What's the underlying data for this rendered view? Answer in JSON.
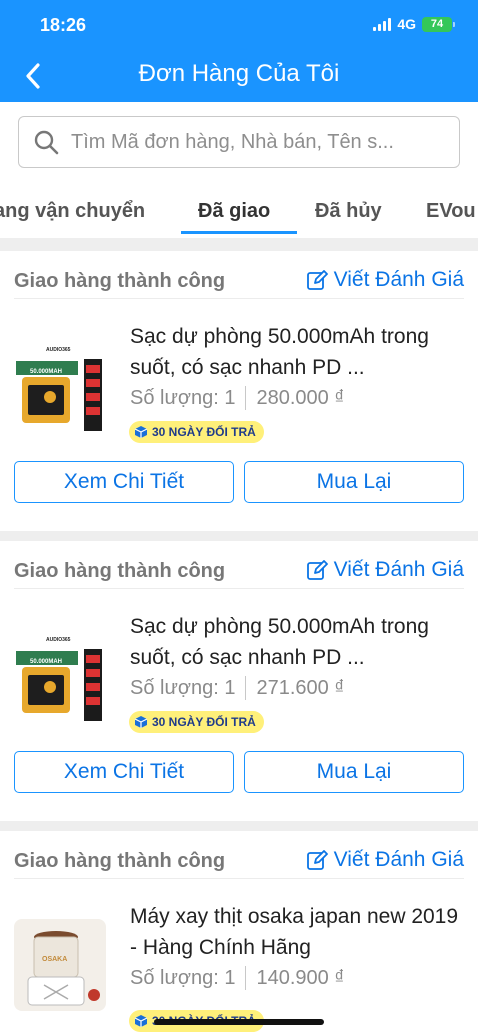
{
  "status_bar": {
    "time": "18:26",
    "network": "4G",
    "battery": "74"
  },
  "header": {
    "title": "Đơn Hàng Của Tôi"
  },
  "search": {
    "placeholder": "Tìm Mã đơn hàng, Nhà bán, Tên s..."
  },
  "tabs": [
    {
      "label": "ang vận chuyển",
      "active": false
    },
    {
      "label": "Đã giao",
      "active": true
    },
    {
      "label": "Đã hủy",
      "active": false
    },
    {
      "label": "EVou",
      "active": false
    }
  ],
  "orders": [
    {
      "status": "Giao hàng thành công",
      "review_label": "Viết Đánh Giá",
      "product_name": "Sạc dự phòng 50.000mAh trong suốt, có sạc nhanh PD ...",
      "quantity_label": "Số lượng: 1",
      "price": "280.000 ₫",
      "badge": "30 NGÀY ĐỔI TRẢ",
      "detail_label": "Xem Chi Tiết",
      "rebuy_label": "Mua Lại",
      "thumb_text": {
        "brand": "AUDIO365",
        "capacity": "50.000MAH"
      }
    },
    {
      "status": "Giao hàng thành công",
      "review_label": "Viết Đánh Giá",
      "product_name": "Sạc dự phòng 50.000mAh trong suốt, có sạc nhanh PD ...",
      "quantity_label": "Số lượng: 1",
      "price": "271.600 ₫",
      "badge": "30 NGÀY ĐỔI TRẢ",
      "detail_label": "Xem Chi Tiết",
      "rebuy_label": "Mua Lại",
      "thumb_text": {
        "brand": "AUDIO365",
        "capacity": "50.000MAH"
      }
    },
    {
      "status": "Giao hàng thành công",
      "review_label": "Viết Đánh Giá",
      "product_name": "Máy xay thịt osaka japan new 2019 - Hàng Chính Hãng",
      "quantity_label": "Số lượng: 1",
      "price": "140.900 ₫",
      "badge": "30 NGÀY ĐỔI TRẢ",
      "thumb_text": {
        "brand": "OSAKA"
      }
    }
  ],
  "colors": {
    "brand": "#1a94ff",
    "link": "#0b74e5",
    "badge_bg": "#fff07a"
  }
}
